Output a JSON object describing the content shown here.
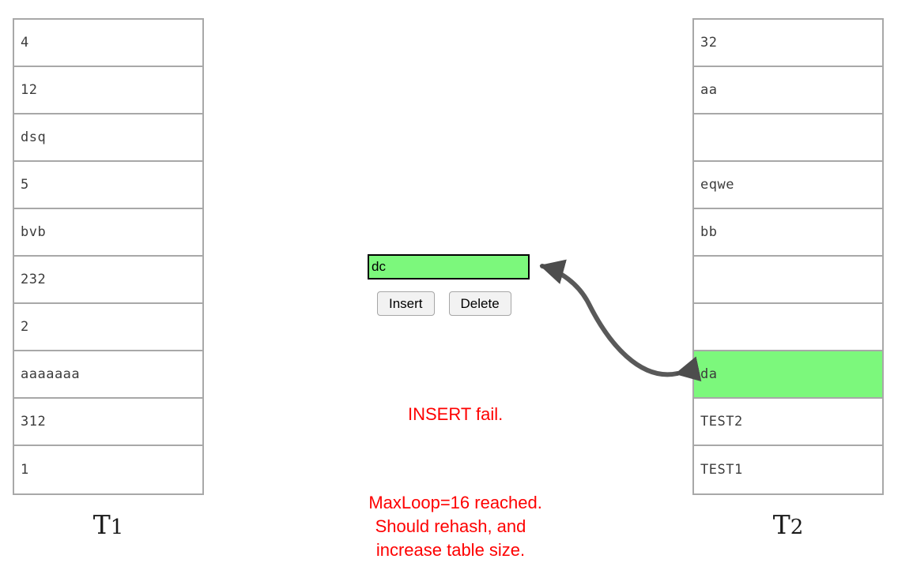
{
  "tables": [
    {
      "id": "t1",
      "label_main": "T",
      "label_sub": "1",
      "rows": [
        "4",
        "12",
        "dsq",
        "5",
        "bvb",
        "232",
        "2",
        "aaaaaaa",
        "312",
        "1"
      ],
      "highlight_index": -1
    },
    {
      "id": "t2",
      "label_main": "T",
      "label_sub": "2",
      "rows": [
        "32",
        "aa",
        "",
        "eqwe",
        "bb",
        "",
        "",
        "da",
        "TEST2",
        "TEST1"
      ],
      "highlight_index": 7
    }
  ],
  "controls": {
    "input_value": "dc",
    "input_placeholder": "",
    "insert_label": "Insert",
    "delete_label": "Delete"
  },
  "status": {
    "line1": "INSERT fail.",
    "line2": "MaxLoop=16 reached. Should rehash, and increase table size."
  },
  "colors": {
    "highlight_green": "#7cf87c",
    "error_red": "#fe0000",
    "table_border": "#a8a8a8",
    "arrow_gray": "#595959"
  },
  "arrow": {
    "name": "cuckoo-displacement-arrow",
    "heads": "double"
  }
}
